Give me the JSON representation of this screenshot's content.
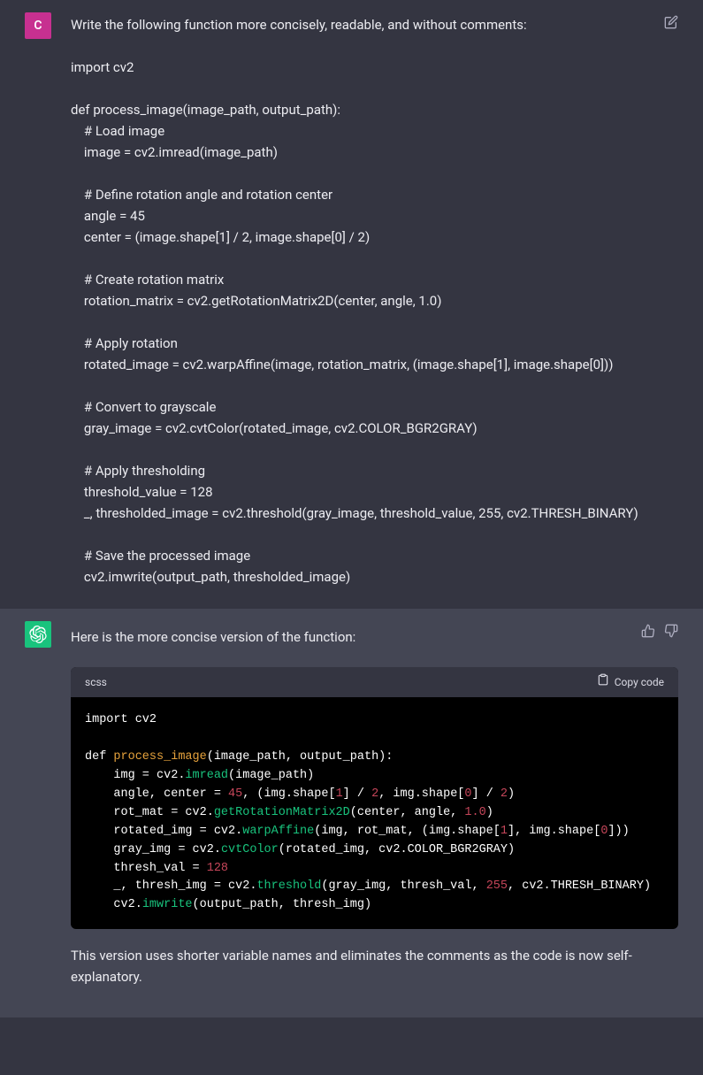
{
  "user": {
    "avatar_letter": "C",
    "prompt_lines": [
      "Write the following function more concisely, readable, and without comments:",
      "",
      "import cv2",
      "",
      "def process_image(image_path, output_path):",
      "    # Load image",
      "    image = cv2.imread(image_path)",
      "",
      "    # Define rotation angle and rotation center",
      "    angle = 45",
      "    center = (image.shape[1] / 2, image.shape[0] / 2)",
      "",
      "    # Create rotation matrix",
      "    rotation_matrix = cv2.getRotationMatrix2D(center, angle, 1.0)",
      "",
      "    # Apply rotation",
      "    rotated_image = cv2.warpAffine(image, rotation_matrix, (image.shape[1], image.shape[0]))",
      "",
      "    # Convert to grayscale",
      "    gray_image = cv2.cvtColor(rotated_image, cv2.COLOR_BGR2GRAY)",
      "",
      "    # Apply thresholding",
      "    threshold_value = 128",
      "    _, thresholded_image = cv2.threshold(gray_image, threshold_value, 255, cv2.THRESH_BINARY)",
      "",
      "    # Save the processed image",
      "    cv2.imwrite(output_path, thresholded_image)"
    ]
  },
  "assistant": {
    "intro": "Here is the more concise version of the function:",
    "code_lang": "scss",
    "copy_label": "Copy code",
    "code_tokens": [
      [
        [
          "kw",
          "import"
        ],
        [
          "txt",
          " cv2"
        ]
      ],
      [],
      [
        [
          "kw",
          "def "
        ],
        [
          "fn",
          "process_image"
        ],
        [
          "txt",
          "(image_path, output_path):"
        ]
      ],
      [
        [
          "txt",
          "    img = cv2."
        ],
        [
          "call",
          "imread"
        ],
        [
          "txt",
          "(image_path)"
        ]
      ],
      [
        [
          "txt",
          "    angle, center = "
        ],
        [
          "num",
          "45"
        ],
        [
          "txt",
          ", (img.shape["
        ],
        [
          "num",
          "1"
        ],
        [
          "txt",
          "] / "
        ],
        [
          "num",
          "2"
        ],
        [
          "txt",
          ", img.shape["
        ],
        [
          "num",
          "0"
        ],
        [
          "txt",
          "] / "
        ],
        [
          "num",
          "2"
        ],
        [
          "txt",
          ")"
        ]
      ],
      [
        [
          "txt",
          "    rot_mat = cv2."
        ],
        [
          "call",
          "getRotationMatrix2D"
        ],
        [
          "txt",
          "(center, angle, "
        ],
        [
          "num",
          "1.0"
        ],
        [
          "txt",
          ")"
        ]
      ],
      [
        [
          "txt",
          "    rotated_img = cv2."
        ],
        [
          "call",
          "warpAffine"
        ],
        [
          "txt",
          "(img, rot_mat, (img.shape["
        ],
        [
          "num",
          "1"
        ],
        [
          "txt",
          "], img.shape["
        ],
        [
          "num",
          "0"
        ],
        [
          "txt",
          "]))"
        ]
      ],
      [
        [
          "txt",
          "    gray_img = cv2."
        ],
        [
          "call",
          "cvtColor"
        ],
        [
          "txt",
          "(rotated_img, cv2.COLOR_BGR2GRAY)"
        ]
      ],
      [
        [
          "txt",
          "    thresh_val = "
        ],
        [
          "num",
          "128"
        ]
      ],
      [
        [
          "txt",
          "    _, thresh_img = cv2."
        ],
        [
          "call",
          "threshold"
        ],
        [
          "txt",
          "(gray_img, thresh_val, "
        ],
        [
          "num",
          "255"
        ],
        [
          "txt",
          ", cv2.THRESH_BINARY)"
        ]
      ],
      [
        [
          "txt",
          "    cv2."
        ],
        [
          "call",
          "imwrite"
        ],
        [
          "txt",
          "(output_path, thresh_img)"
        ]
      ]
    ],
    "outro": "This version uses shorter variable names and eliminates the comments as the code is now self-explanatory."
  }
}
